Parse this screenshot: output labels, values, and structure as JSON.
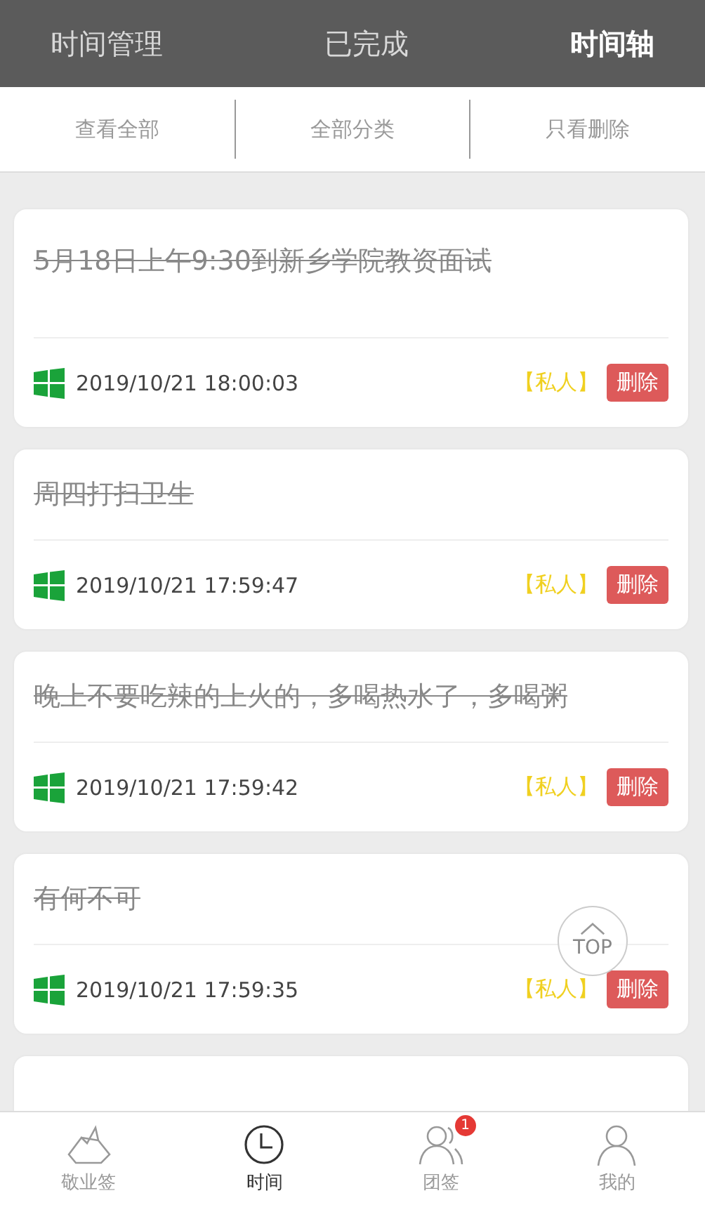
{
  "header_tabs": [
    {
      "label": "时间管理",
      "selected": false
    },
    {
      "label": "已完成",
      "selected": false
    },
    {
      "label": "时间轴",
      "selected": true
    }
  ],
  "filters": [
    "查看全部",
    "全部分类",
    "只看删除"
  ],
  "items": [
    {
      "title": "5月18日上午9:30到新乡学院教资面试",
      "struck": true,
      "time": "2019/10/21 18:00:03",
      "category": "【私人】",
      "action": "删除"
    },
    {
      "title": "周四打扫卫生",
      "struck": true,
      "time": "2019/10/21 17:59:47",
      "category": "【私人】",
      "action": "删除"
    },
    {
      "title": "晚上不要吃辣的上火的，多喝热水了，多喝粥",
      "struck": true,
      "time": "2019/10/21 17:59:42",
      "category": "【私人】",
      "action": "删除"
    },
    {
      "title": "有何不可",
      "struck": true,
      "time": "2019/10/21 17:59:35",
      "category": "【私人】",
      "action": "删除"
    }
  ],
  "top_button": {
    "label": "TOP"
  },
  "bottom_nav": [
    {
      "label": "敬业签",
      "selected": false
    },
    {
      "label": "时间",
      "selected": true
    },
    {
      "label": "团签",
      "selected": false,
      "badge": "1"
    },
    {
      "label": "我的",
      "selected": false
    }
  ]
}
